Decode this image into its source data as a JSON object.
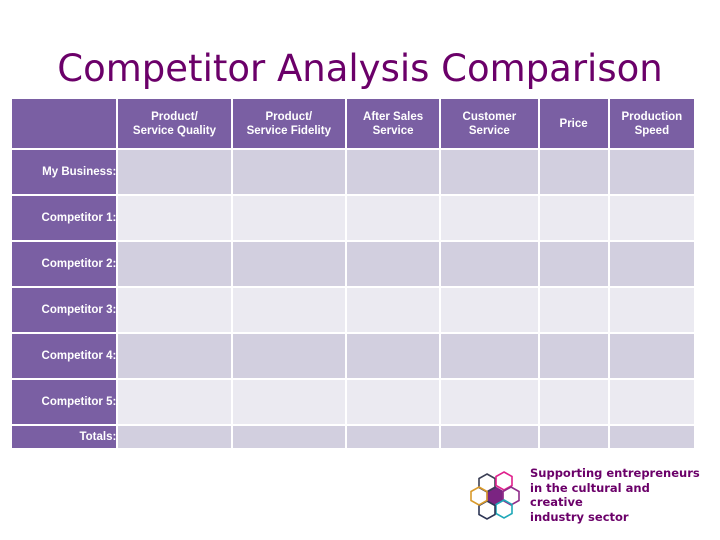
{
  "page": {
    "title": "Competitor Analysis Comparison",
    "title_color": "#6b0069",
    "background": "#ffffff"
  },
  "table": {
    "header_background": "#7a5fa3",
    "header_text_color": "#ffffff",
    "cell_dark": "#d2cfdf",
    "cell_light": "#ebeaf1",
    "corner_label": "",
    "columns": [
      {
        "label": "",
        "key": "label"
      },
      {
        "label": "Product/\nService Quality",
        "key": "quality"
      },
      {
        "label": "Product/\nService Fidelity",
        "key": "fidelity"
      },
      {
        "label": "After Sales\nService",
        "key": "after_sales"
      },
      {
        "label": "Customer\nService",
        "key": "customer_service"
      },
      {
        "label": "Price",
        "key": "price"
      },
      {
        "label": "Production\nSpeed",
        "key": "production_speed"
      }
    ],
    "rows": [
      {
        "label": "My Business:",
        "values": [
          "",
          "",
          "",
          "",
          "",
          ""
        ]
      },
      {
        "label": "Competitor 1:",
        "values": [
          "",
          "",
          "",
          "",
          "",
          ""
        ]
      },
      {
        "label": "Competitor 2:",
        "values": [
          "",
          "",
          "",
          "",
          "",
          ""
        ]
      },
      {
        "label": "Competitor 3:",
        "values": [
          "",
          "",
          "",
          "",
          "",
          ""
        ]
      },
      {
        "label": "Competitor 4:",
        "values": [
          "",
          "",
          "",
          "",
          "",
          ""
        ]
      },
      {
        "label": "Competitor 5:",
        "values": [
          "",
          "",
          "",
          "",
          "",
          ""
        ]
      }
    ],
    "totals_row": {
      "label": "Totals:",
      "values": [
        "",
        "",
        "",
        "",
        "",
        ""
      ]
    }
  },
  "logo": {
    "mark_name": "hexagon-flower-icon",
    "text": "Supporting entrepreneurs\nin the cultural and creative\nindustry sector",
    "text_color": "#6b0069",
    "petal_colors": {
      "center": "#7b2482",
      "top_left": "#3b3f55",
      "top_right": "#e0208c",
      "right": "#8f2d8a",
      "bottom_right": "#1fa8b8",
      "bottom_left": "#2d3555",
      "left": "#d99a2b"
    }
  }
}
